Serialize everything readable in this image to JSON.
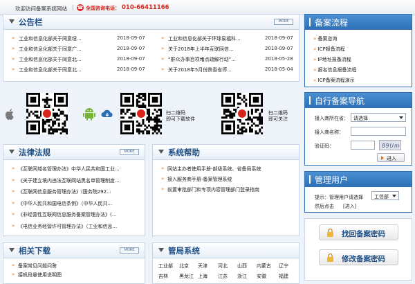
{
  "topbar": {
    "welcome": "欢迎访问备案系统网站",
    "separator": "|",
    "phone_label": "全国咨询电话：",
    "phone_number": "010-66411166"
  },
  "notice": {
    "title": "公告栏",
    "more_label": "MORE",
    "left_items": [
      {
        "title": "工业和信息化部关于同意纽...",
        "date": "2018-09-07"
      },
      {
        "title": "工业和信息化部关于同意广...",
        "date": "2018-09-07"
      },
      {
        "title": "工业和信息化部关于同意北...",
        "date": "2018-09-07"
      },
      {
        "title": "工业和信息化部关于同意北...",
        "date": "2018-09-07"
      }
    ],
    "right_items": [
      {
        "title": "工业和信息化部关于环球易福科...",
        "date": "2018-09-07"
      },
      {
        "title": "关于2018年上半年互联网信...",
        "date": "2018-09-07"
      },
      {
        "title": "“群众办事百项堵点疏解行动”...",
        "date": "2018-05-28"
      },
      {
        "title": "关于2018年5月份跌香省停...",
        "date": "2018-05-04"
      }
    ]
  },
  "apps": {
    "scan_ios_label": "扫二维码",
    "scan_ios_sub": "即可下载软件",
    "scan_wx_label": "扫二维码",
    "scan_wx_sub": "即可关注"
  },
  "laws": {
    "title": "法律法规",
    "more_label": "MORE",
    "items": [
      "《互联网域名管理办法》中华人民共和国工业...",
      "《关于建立境内违法互联网站黑名单管理制度...",
      "《互联网信息服务管理办法》(国务院292...",
      "《中华人民共和国电信条例》（中华人民共...",
      "《非经营性互联网信息服务备案管理办法》(...",
      "《电信业务经营许可管理办法》（工业和信息..."
    ]
  },
  "help": {
    "title": "系统帮助",
    "items": [
      "网站主办者使用手册-部级系统、省备局系统",
      "接入服务商手册-备案管理系统",
      "前置审批部门和专项内容管理部门登录指南"
    ]
  },
  "downloads": {
    "title": "相关下载",
    "more_label": "MORE",
    "items": [
      "备案常见问题问答",
      "接帆段悬使用说明图"
    ]
  },
  "bureaus": {
    "title": "管局系统",
    "row1": [
      "工业部",
      "北京",
      "天津",
      "河北",
      "山西",
      "内蒙古",
      "辽宁"
    ],
    "row2": [
      "吉林",
      "黑龙江",
      "上海",
      "江苏",
      "浙江",
      "安徽",
      "福建"
    ]
  },
  "flow": {
    "title": "备案流程",
    "items": [
      "备案咨询",
      "ICP报备流程",
      "IP地址报备流程",
      "报名信息报备流程",
      "ICP备案流程演示"
    ]
  },
  "nav": {
    "title": "自行备案导航",
    "province_label": "接入商所在省：",
    "province_value": "请选择",
    "provider_label": "接入商名称：",
    "captcha_label": "验证码：",
    "captcha_text": "89Um",
    "go_label": "进入"
  },
  "user": {
    "title": "管理用户",
    "tip_prefix": "提示：管理用户请选择",
    "select_value": "工信部",
    "tip_suffix": "然后点击",
    "enter_label": "[进入]"
  },
  "password": {
    "find_label": "找回备案密码",
    "change_label": "修改备案密码"
  }
}
